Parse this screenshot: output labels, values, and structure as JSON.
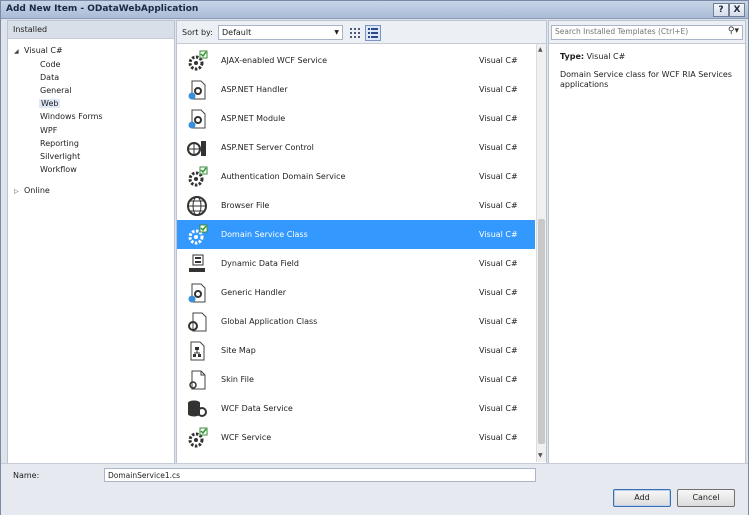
{
  "window": {
    "title": "Add New Item - ODataWebApplication",
    "help_glyph": "?",
    "close_glyph": "X"
  },
  "left_panel": {
    "header": "Installed",
    "root": "Visual C#",
    "children": [
      "Code",
      "Data",
      "General",
      "Web",
      "Windows Forms",
      "WPF",
      "Reporting",
      "Silverlight",
      "Workflow"
    ],
    "selected": "Web",
    "online": "Online"
  },
  "toolbar": {
    "sort_label": "Sort by:",
    "sort_value": "Default"
  },
  "items": [
    {
      "name": "AJAX-enabled WCF Service",
      "lang": "Visual C#",
      "icon": "gear-icon"
    },
    {
      "name": "ASP.NET Handler",
      "lang": "Visual C#",
      "icon": "page-gear-icon"
    },
    {
      "name": "ASP.NET Module",
      "lang": "Visual C#",
      "icon": "page-gear-icon"
    },
    {
      "name": "ASP.NET Server Control",
      "lang": "Visual C#",
      "icon": "globe-control-icon"
    },
    {
      "name": "Authentication Domain Service",
      "lang": "Visual C#",
      "icon": "gear-icon"
    },
    {
      "name": "Browser File",
      "lang": "Visual C#",
      "icon": "globe-icon"
    },
    {
      "name": "Domain Service Class",
      "lang": "Visual C#",
      "icon": "gear-icon"
    },
    {
      "name": "Dynamic Data Field",
      "lang": "Visual C#",
      "icon": "data-field-icon"
    },
    {
      "name": "Generic Handler",
      "lang": "Visual C#",
      "icon": "page-gear-icon"
    },
    {
      "name": "Global Application Class",
      "lang": "Visual C#",
      "icon": "page-gear-icon"
    },
    {
      "name": "Site Map",
      "lang": "Visual C#",
      "icon": "sitemap-icon"
    },
    {
      "name": "Skin File",
      "lang": "Visual C#",
      "icon": "page-icon"
    },
    {
      "name": "WCF Data Service",
      "lang": "Visual C#",
      "icon": "database-icon"
    },
    {
      "name": "WCF Service",
      "lang": "Visual C#",
      "icon": "gear-icon"
    }
  ],
  "selected_item": "Domain Service Class",
  "search": {
    "placeholder": "Search Installed Templates (Ctrl+E)"
  },
  "details": {
    "type_label": "Type:",
    "type_value": "Visual C#",
    "description": "Domain Service class for WCF RIA Services applications"
  },
  "bottom": {
    "name_label": "Name:",
    "name_value": "DomainService1.cs",
    "add_label": "Add",
    "cancel_label": "Cancel"
  },
  "colors": {
    "selection": "#3399ff",
    "title_bar": "#b9c8df"
  }
}
